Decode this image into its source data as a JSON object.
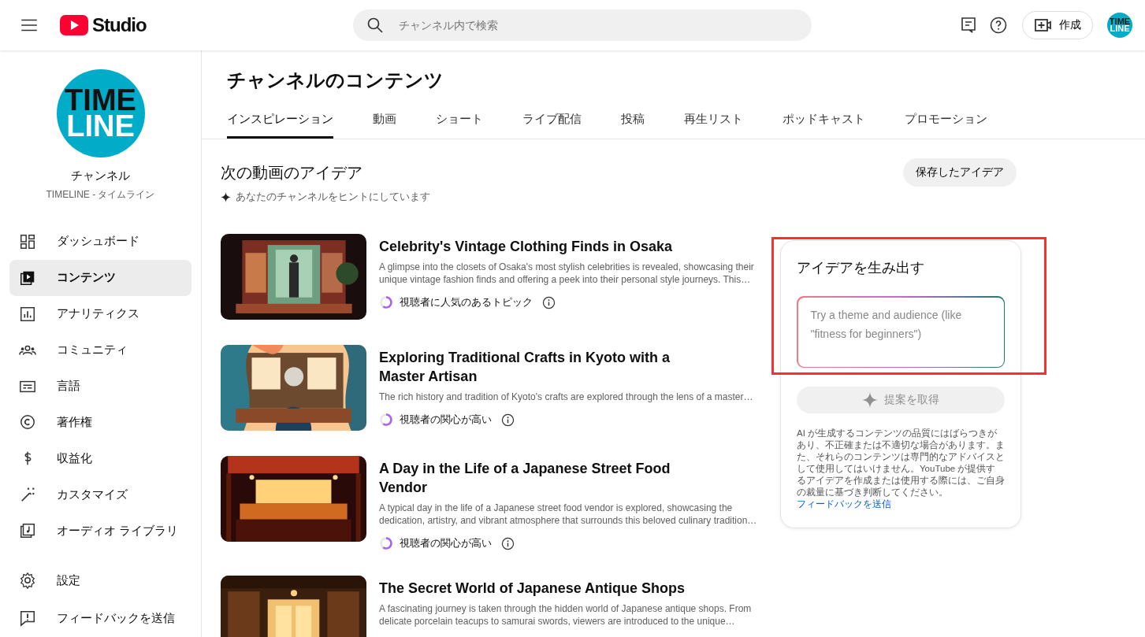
{
  "header": {
    "brand": "Studio",
    "search": {
      "placeholder": "チャンネル内で検索"
    },
    "create_button": "作成",
    "avatar_logo": [
      "TIME",
      "LINE"
    ]
  },
  "sidebar": {
    "channel": {
      "logo": [
        "TIME",
        "LINE"
      ],
      "title": "チャンネル",
      "name": "TIMELINE - タイムライン"
    },
    "items": [
      {
        "label": "ダッシュボード",
        "selected": false
      },
      {
        "label": "コンテンツ",
        "selected": true
      },
      {
        "label": "アナリティクス",
        "selected": false
      },
      {
        "label": "コミュニティ",
        "selected": false
      },
      {
        "label": "言語",
        "selected": false
      },
      {
        "label": "著作権",
        "selected": false
      },
      {
        "label": "収益化",
        "selected": false
      },
      {
        "label": "カスタマイズ",
        "selected": false
      },
      {
        "label": "オーディオ ライブラリ",
        "selected": false
      }
    ],
    "footer_items": [
      {
        "label": "設定",
        "selected": false
      },
      {
        "label": "フィードバックを送信",
        "selected": false
      }
    ]
  },
  "page": {
    "title": "チャンネルのコンテンツ",
    "tabs": [
      {
        "label": "インスピレーション",
        "selected": true
      },
      {
        "label": "動画",
        "selected": false
      },
      {
        "label": "ショート",
        "selected": false
      },
      {
        "label": "ライブ配信",
        "selected": false
      },
      {
        "label": "投稿",
        "selected": false
      },
      {
        "label": "再生リスト",
        "selected": false
      },
      {
        "label": "ポッドキャスト",
        "selected": false
      },
      {
        "label": "プロモーション",
        "selected": false
      }
    ]
  },
  "ideas": {
    "title": "次の動画のアイデア",
    "saved_button": "保存したアイデア",
    "hint": "あなたのチャンネルをヒントにしています",
    "items": [
      {
        "title": "Celebrity's Vintage Clothing Finds in Osaka",
        "description": "A glimpse into the closets of Osaka's most stylish celebrities is revealed, showcasing their unique vintage fashion finds and offering a peek into their personal style journeys. This…",
        "tag": "視聴者に人気のあるトピック"
      },
      {
        "title": "Exploring Traditional Crafts in Kyoto with a Master Artisan",
        "description": "The rich history and tradition of Kyoto's crafts are explored through the lens of a master…",
        "tag": "視聴者の関心が高い"
      },
      {
        "title": "A Day in the Life of a Japanese Street Food Vendor",
        "description": "A typical day in the life of a Japanese street food vendor is explored, showcasing the dedication, artistry, and vibrant atmosphere that surrounds this beloved culinary tradition…",
        "tag": "視聴者の関心が高い"
      },
      {
        "title": "The Secret World of Japanese Antique Shops",
        "description": "A fascinating journey is taken through the hidden world of Japanese antique shops. From delicate porcelain teacups to samurai swords, viewers are introduced to the unique…"
      }
    ]
  },
  "generator": {
    "title": "アイデアを生み出す",
    "highlighted": true,
    "prompt": {
      "placeholder": "Try a theme and audience (like \"fitness for beginners\")"
    },
    "button": {
      "label": "提案を取得",
      "disabled": true
    },
    "disclaimer": "AI が生成するコンテンツの品質にはばらつきがあり、不正確または不適切な場合があります。また、それらのコンテンツは専門的なアドバイスとして使用してはいけません。YouTube が提供するアイデアを作成または使用する際には、ご自身の裁量に基づき判断してください。",
    "feedback_link": "フィードバックを送信"
  }
}
